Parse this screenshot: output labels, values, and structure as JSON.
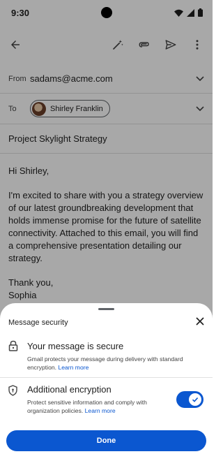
{
  "status_bar": {
    "time": "9:30",
    "icons": [
      "wifi-icon",
      "signal-icon",
      "battery-icon"
    ]
  },
  "toolbar": {
    "icons": [
      "back-arrow-icon",
      "magic-pen-icon",
      "attach-icon",
      "send-icon",
      "more-vert-icon"
    ]
  },
  "compose": {
    "from_label": "From",
    "from_value": "sadams@acme.com",
    "to_label": "To",
    "to_chip": "Shirley Franklin",
    "subject": "Project Skylight Strategy",
    "body": {
      "greeting": "Hi Shirley,",
      "paragraph": "I'm excited to share with you a strategy overview of our latest groundbreaking development that holds immense promise for the future of satellite connectivity. Attached to this email, you will find a comprehensive presentation detailing our strategy.",
      "closing": "Thank you,",
      "signature": "Sophia"
    }
  },
  "sheet": {
    "title": "Message security",
    "secure": {
      "title": "Your message is secure",
      "description": "Gmail protects your message during delivery with standard encryption.",
      "link": "Learn more"
    },
    "encryption": {
      "title": "Additional encryption",
      "description": "Protect sensitive information and comply with organization policies.",
      "link": "Learn more",
      "enabled": true
    },
    "done_label": "Done"
  },
  "colors": {
    "accent": "#0b57d0",
    "scrim": "rgba(0,0,0,0.34)"
  }
}
